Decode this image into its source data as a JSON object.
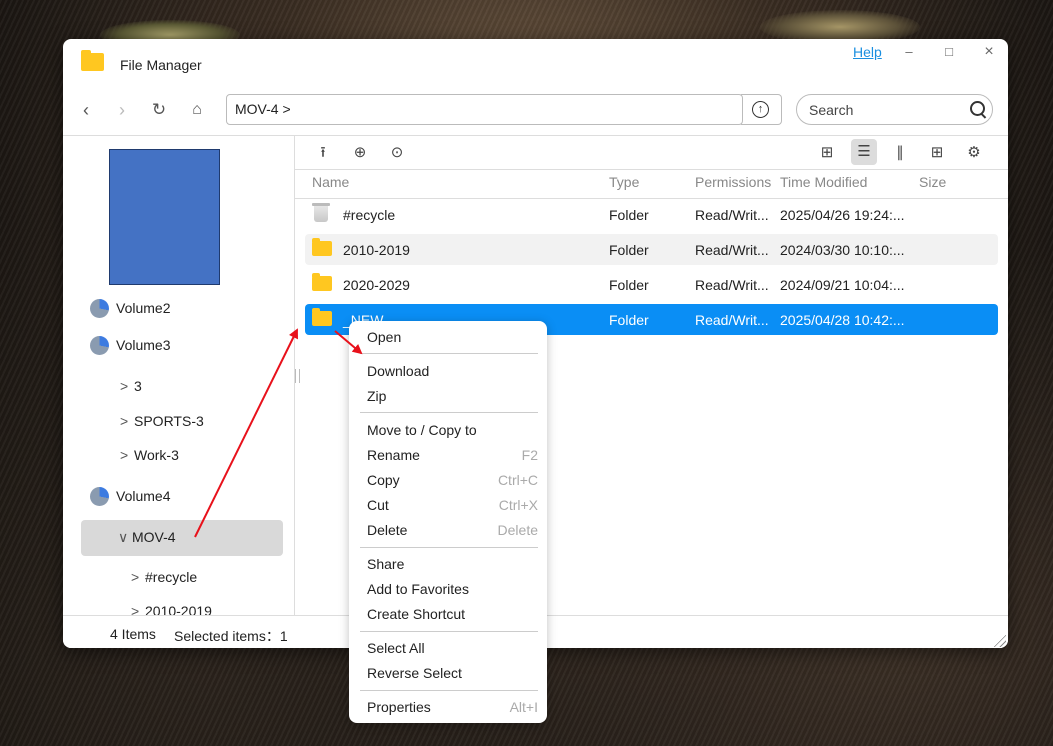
{
  "window": {
    "title": "File Manager",
    "help": "Help",
    "minimize": "–",
    "maximize": "□",
    "close": "×"
  },
  "nav": {
    "address": "MOV-4 >",
    "search_placeholder": "Search"
  },
  "sidebar": {
    "volumes": [
      {
        "label": "Volume2"
      },
      {
        "label": "Volume3"
      },
      {
        "label": "Volume4"
      }
    ],
    "tree": [
      {
        "label": "3",
        "chevron": ">"
      },
      {
        "label": "SPORTS-3",
        "chevron": ">"
      },
      {
        "label": "Work-3",
        "chevron": ">"
      },
      {
        "label": "MOV-4",
        "chevron": "∨"
      },
      {
        "label": "#recycle",
        "chevron": ">"
      },
      {
        "label": "2010-2019",
        "chevron": ">"
      }
    ]
  },
  "columns": {
    "name": "Name",
    "type": "Type",
    "permissions": "Permissions",
    "modified": "Time Modified",
    "size": "Size"
  },
  "files": [
    {
      "name": "#recycle",
      "type": "Folder",
      "permissions": "Read/Writ...",
      "modified": "2025/04/26 19:24:..."
    },
    {
      "name": "2010-2019",
      "type": "Folder",
      "permissions": "Read/Writ...",
      "modified": "2024/03/30 10:10:..."
    },
    {
      "name": "2020-2029",
      "type": "Folder",
      "permissions": "Read/Writ...",
      "modified": "2024/09/21 10:04:..."
    },
    {
      "name": "_NEW",
      "type": "Folder",
      "permissions": "Read/Writ...",
      "modified": "2025/04/28 10:42:..."
    }
  ],
  "status": {
    "items": "4 Items",
    "selected": "Selected items：1"
  },
  "context_menu": [
    {
      "label": "Open",
      "shortcut": ""
    },
    {
      "label": "Download",
      "shortcut": ""
    },
    {
      "label": "Zip",
      "shortcut": ""
    },
    {
      "label": "Move to / Copy to",
      "shortcut": ""
    },
    {
      "label": "Rename",
      "shortcut": "F2"
    },
    {
      "label": "Copy",
      "shortcut": "Ctrl+C"
    },
    {
      "label": "Cut",
      "shortcut": "Ctrl+X"
    },
    {
      "label": "Delete",
      "shortcut": "Delete"
    },
    {
      "label": "Share",
      "shortcut": ""
    },
    {
      "label": "Add to Favorites",
      "shortcut": ""
    },
    {
      "label": "Create Shortcut",
      "shortcut": ""
    },
    {
      "label": "Select All",
      "shortcut": ""
    },
    {
      "label": "Reverse Select",
      "shortcut": ""
    },
    {
      "label": "Properties",
      "shortcut": "Alt+I"
    }
  ],
  "colors": {
    "accent": "#0a8ef5",
    "folder": "#ffc720",
    "annotation": "#e8111b",
    "thumbnail": "#4472c4"
  }
}
